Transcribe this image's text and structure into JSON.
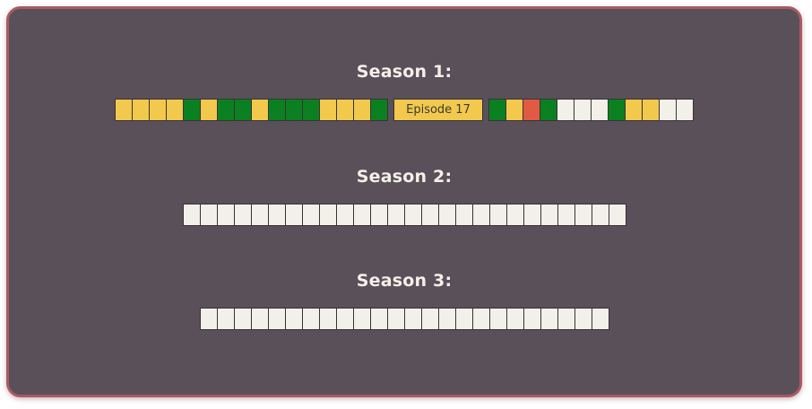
{
  "colors": {
    "panel": "#5a5059",
    "border": "#a85a62",
    "yellow": "#f2c94c",
    "green": "#0a8020",
    "red": "#e05a44",
    "white": "#f2f0e9"
  },
  "seasons": [
    {
      "title": "Season 1:",
      "current_episode_label": "Episode 17",
      "before": [
        "yellow",
        "yellow",
        "yellow",
        "yellow",
        "green",
        "yellow",
        "green",
        "green",
        "yellow",
        "green",
        "green",
        "green",
        "yellow",
        "yellow",
        "yellow",
        "green"
      ],
      "after": [
        "green",
        "yellow",
        "red",
        "green",
        "white",
        "white",
        "white",
        "green",
        "yellow",
        "yellow",
        "white",
        "white"
      ]
    },
    {
      "title": "Season 2:",
      "episodes": [
        "white",
        "white",
        "white",
        "white",
        "white",
        "white",
        "white",
        "white",
        "white",
        "white",
        "white",
        "white",
        "white",
        "white",
        "white",
        "white",
        "white",
        "white",
        "white",
        "white",
        "white",
        "white",
        "white",
        "white",
        "white",
        "white"
      ]
    },
    {
      "title": "Season 3:",
      "episodes": [
        "white",
        "white",
        "white",
        "white",
        "white",
        "white",
        "white",
        "white",
        "white",
        "white",
        "white",
        "white",
        "white",
        "white",
        "white",
        "white",
        "white",
        "white",
        "white",
        "white",
        "white",
        "white",
        "white",
        "white"
      ]
    }
  ]
}
